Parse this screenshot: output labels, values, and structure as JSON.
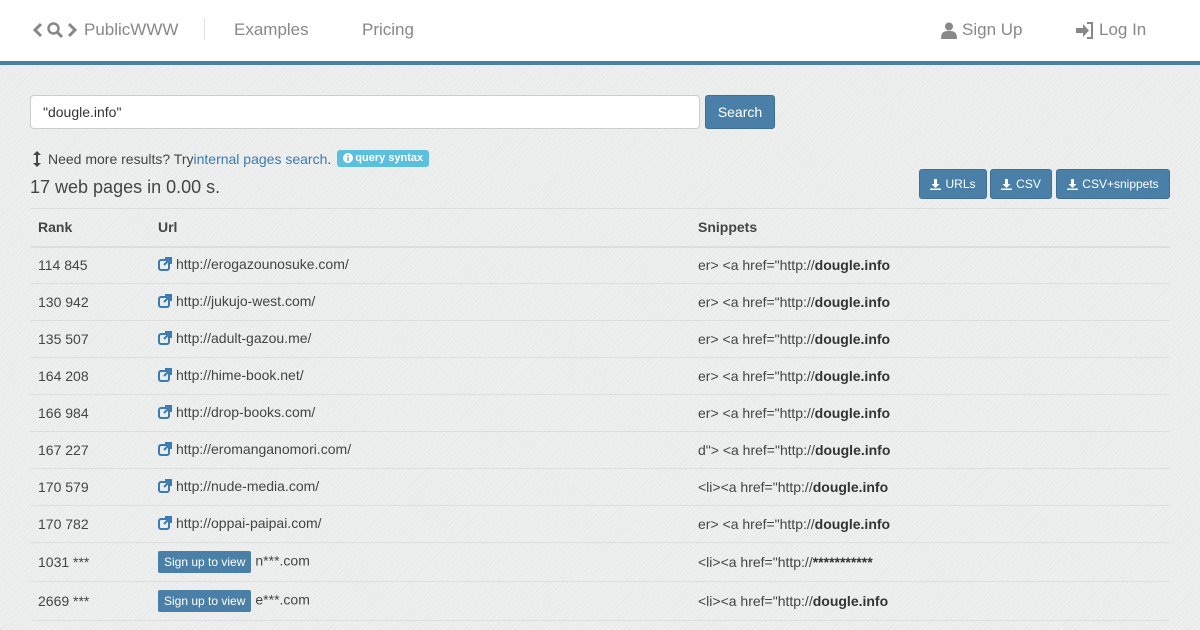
{
  "header": {
    "brand": "PublicWWW",
    "nav": {
      "examples": "Examples",
      "pricing": "Pricing"
    },
    "auth": {
      "signup": "Sign Up",
      "login": "Log In"
    }
  },
  "search": {
    "query": "\"dougle.info\"",
    "button": "Search"
  },
  "hint": {
    "prefix": "Need more results? Try ",
    "link": "internal pages search",
    "suffix": ".",
    "badge": "query syntax"
  },
  "summary": "17 web pages in 0.00 s.",
  "downloads": {
    "urls": "URLs",
    "csv": "CSV",
    "csv_snippets": "CSV+snippets"
  },
  "table": {
    "headers": {
      "rank": "Rank",
      "url": "Url",
      "snippets": "Snippets"
    },
    "rows": [
      {
        "rank": "114 845",
        "url": "http://erogazounosuke.com/",
        "snip_prefix": "er> <a href=\"http://",
        "snip_bold": "dougle.info"
      },
      {
        "rank": "130 942",
        "url": "http://jukujo-west.com/",
        "snip_prefix": "er> <a href=\"http://",
        "snip_bold": "dougle.info"
      },
      {
        "rank": "135 507",
        "url": "http://adult-gazou.me/",
        "snip_prefix": "er> <a href=\"http://",
        "snip_bold": "dougle.info"
      },
      {
        "rank": "164 208",
        "url": "http://hime-book.net/",
        "snip_prefix": "er> <a href=\"http://",
        "snip_bold": "dougle.info"
      },
      {
        "rank": "166 984",
        "url": "http://drop-books.com/",
        "snip_prefix": "er> <a href=\"http://",
        "snip_bold": "dougle.info"
      },
      {
        "rank": "167 227",
        "url": "http://eromanganomori.com/",
        "snip_prefix": "d\"> <a href=\"http://",
        "snip_bold": "dougle.info"
      },
      {
        "rank": "170 579",
        "url": "http://nude-media.com/",
        "snip_prefix": "<li><a href=\"http://",
        "snip_bold": "dougle.info"
      },
      {
        "rank": "170 782",
        "url": "http://oppai-paipai.com/",
        "snip_prefix": "er> <a href=\"http://",
        "snip_bold": "dougle.info"
      }
    ],
    "locked_rows": [
      {
        "rank": "1031 ***",
        "signup": "Sign up to view",
        "domain": "n***.com",
        "snip_prefix": "<li><a href=\"http://",
        "snip_bold": "***********"
      },
      {
        "rank": "2669 ***",
        "signup": "Sign up to view",
        "domain": "e***.com",
        "snip_prefix": "<li><a href=\"http://",
        "snip_bold": "dougle.info"
      }
    ]
  },
  "colors": {
    "accent": "#4a7fa8",
    "link": "#3b7bb0",
    "badge": "#5bc0de"
  }
}
